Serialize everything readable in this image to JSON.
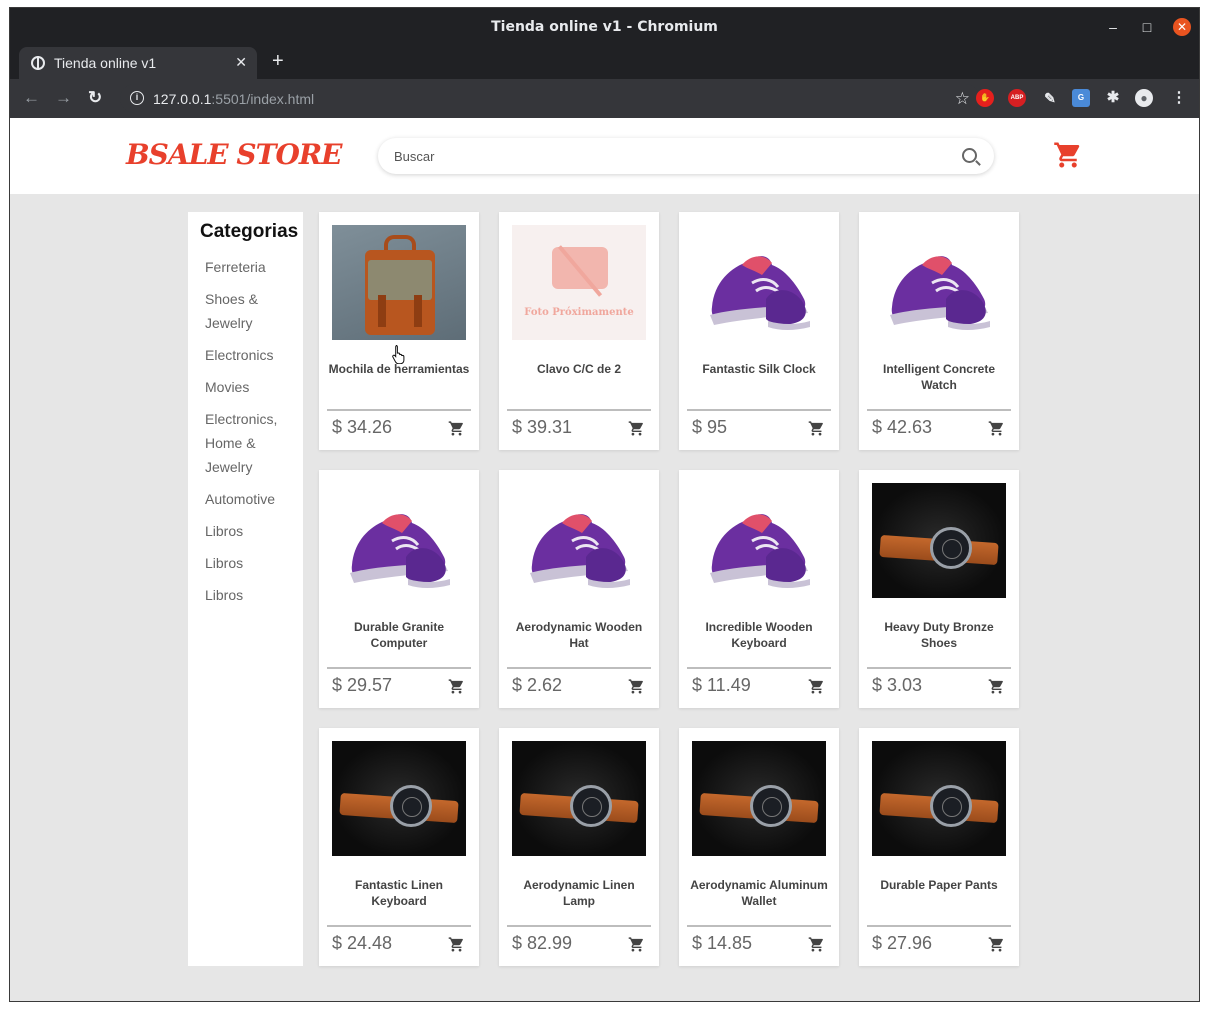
{
  "window": {
    "title": "Tienda online v1 - Chromium",
    "min_label": "–",
    "max_label": "□",
    "close_label": "✕"
  },
  "tabs": [
    {
      "label": "Tienda online v1",
      "close": "✕"
    }
  ],
  "newtab_label": "+",
  "toolbar": {
    "back": "←",
    "forward": "→",
    "reload": "↻",
    "url_host": "127.0.0.1",
    "url_path": ":5501/index.html",
    "star": "☆",
    "extensions": {
      "ext1": "✋",
      "ext2": "ABP",
      "ext3": "✎",
      "ext4": "G",
      "ext5": "✱",
      "profile": "●",
      "menu": "⋮"
    }
  },
  "store": {
    "logo": "BSALE STORE",
    "search_placeholder": "Buscar",
    "accent_color": "#e8402c"
  },
  "sidebar": {
    "title": "Categorias",
    "items": [
      "Ferreteria",
      "Shoes & Jewelry",
      "Electronics",
      "Movies",
      "Electronics, Home & Jewelry",
      "Automotive",
      "Libros",
      "Libros",
      "Libros"
    ]
  },
  "products": [
    {
      "name": "Mochila de herramientas",
      "price": "$ 34.26",
      "image": "bag"
    },
    {
      "name": "Clavo C/C de 2",
      "price": "$ 39.31",
      "image": "placeholder"
    },
    {
      "name": "Fantastic Silk Clock",
      "price": "$ 95",
      "image": "shoe"
    },
    {
      "name": "Intelligent Concrete Watch",
      "price": "$ 42.63",
      "image": "shoe"
    },
    {
      "name": "Durable Granite Computer",
      "price": "$ 29.57",
      "image": "shoe"
    },
    {
      "name": "Aerodynamic Wooden Hat",
      "price": "$ 2.62",
      "image": "shoe"
    },
    {
      "name": "Incredible Wooden Keyboard",
      "price": "$ 11.49",
      "image": "shoe"
    },
    {
      "name": "Heavy Duty Bronze Shoes",
      "price": "$ 3.03",
      "image": "watch"
    },
    {
      "name": "Fantastic Linen Keyboard",
      "price": "$ 24.48",
      "image": "watch"
    },
    {
      "name": "Aerodynamic Linen Lamp",
      "price": "$ 82.99",
      "image": "watch"
    },
    {
      "name": "Aerodynamic Aluminum Wallet",
      "price": "$ 14.85",
      "image": "watch"
    },
    {
      "name": "Durable Paper Pants",
      "price": "$ 27.96",
      "image": "watch"
    }
  ],
  "placeholder_text": "Foto Próximamente"
}
